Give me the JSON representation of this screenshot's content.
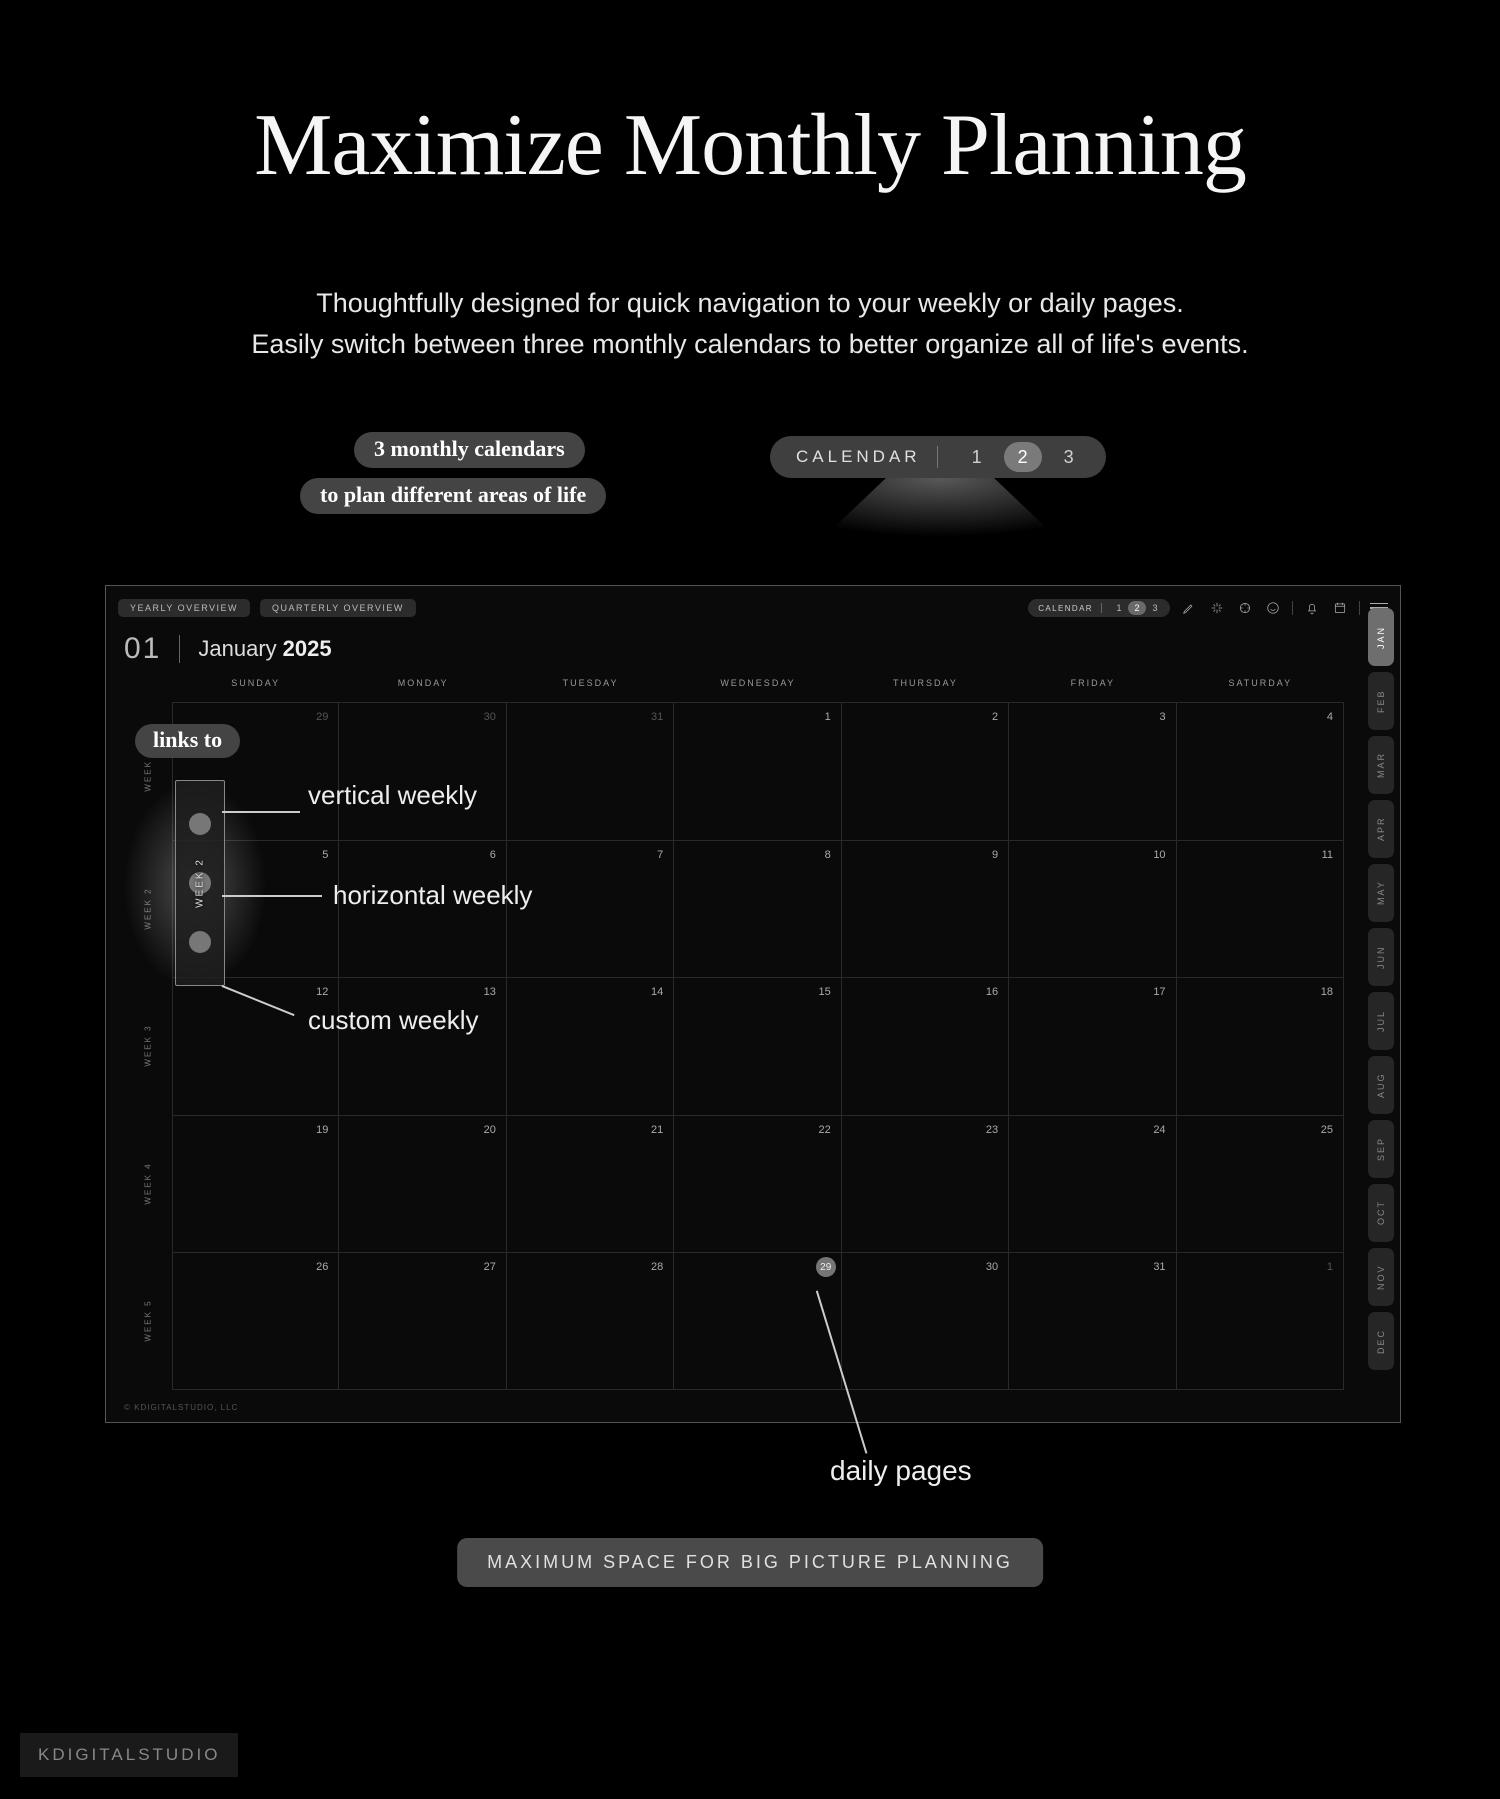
{
  "hero": {
    "title": "Maximize Monthly Planning",
    "subtitle_line1": "Thoughtfully designed for quick navigation to your weekly or daily pages.",
    "subtitle_line2": "Easily switch between three monthly calendars to better organize all of life's events."
  },
  "annotations": {
    "top_pill_1": "3 monthly calendars",
    "top_pill_2": "to plan different areas of life",
    "links_to": "links to",
    "vertical": "vertical weekly",
    "horizontal": "horizontal weekly",
    "custom": "custom weekly",
    "daily": "daily pages",
    "bottom": "MAXIMUM SPACE FOR BIG PICTURE PLANNING"
  },
  "big_toggle": {
    "label": "CALENDAR",
    "options": [
      "1",
      "2",
      "3"
    ],
    "active": "2"
  },
  "planner": {
    "overview_buttons": [
      "YEARLY OVERVIEW",
      "QUARTERLY OVERVIEW"
    ],
    "mini_toggle": {
      "label": "CALENDAR",
      "options": [
        "1",
        "2",
        "3"
      ],
      "active": "2"
    },
    "month_num": "01",
    "month_name": "January",
    "month_year": "2025",
    "day_headers": [
      "SUNDAY",
      "MONDAY",
      "TUESDAY",
      "WEDNESDAY",
      "THURSDAY",
      "FRIDAY",
      "SATURDAY"
    ],
    "week_labels": [
      "WEEK 1",
      "WEEK 2",
      "WEEK 3",
      "WEEK 4",
      "WEEK 5"
    ],
    "month_tabs": [
      "JAN",
      "FEB",
      "MAR",
      "APR",
      "MAY",
      "JUN",
      "JUL",
      "AUG",
      "SEP",
      "OCT",
      "NOV",
      "DEC"
    ],
    "month_tab_active": "JAN",
    "footer": "© KDIGITALSTUDIO, LLC",
    "popover_week": "WEEK 2",
    "circled_day": "29",
    "cells": [
      {
        "n": "29",
        "dim": true
      },
      {
        "n": "30",
        "dim": true
      },
      {
        "n": "31",
        "dim": true
      },
      {
        "n": "1"
      },
      {
        "n": "2"
      },
      {
        "n": "3"
      },
      {
        "n": "4"
      },
      {
        "n": "5"
      },
      {
        "n": "6"
      },
      {
        "n": "7"
      },
      {
        "n": "8"
      },
      {
        "n": "9"
      },
      {
        "n": "10"
      },
      {
        "n": "11"
      },
      {
        "n": "12"
      },
      {
        "n": "13"
      },
      {
        "n": "14"
      },
      {
        "n": "15"
      },
      {
        "n": "16"
      },
      {
        "n": "17"
      },
      {
        "n": "18"
      },
      {
        "n": "19"
      },
      {
        "n": "20"
      },
      {
        "n": "21"
      },
      {
        "n": "22"
      },
      {
        "n": "23"
      },
      {
        "n": "24"
      },
      {
        "n": "25"
      },
      {
        "n": "26"
      },
      {
        "n": "27"
      },
      {
        "n": "28"
      },
      {
        "n": "29",
        "circled": true
      },
      {
        "n": "30"
      },
      {
        "n": "31"
      },
      {
        "n": "1",
        "dim": true
      }
    ]
  },
  "watermark": "KDIGITALSTUDIO"
}
